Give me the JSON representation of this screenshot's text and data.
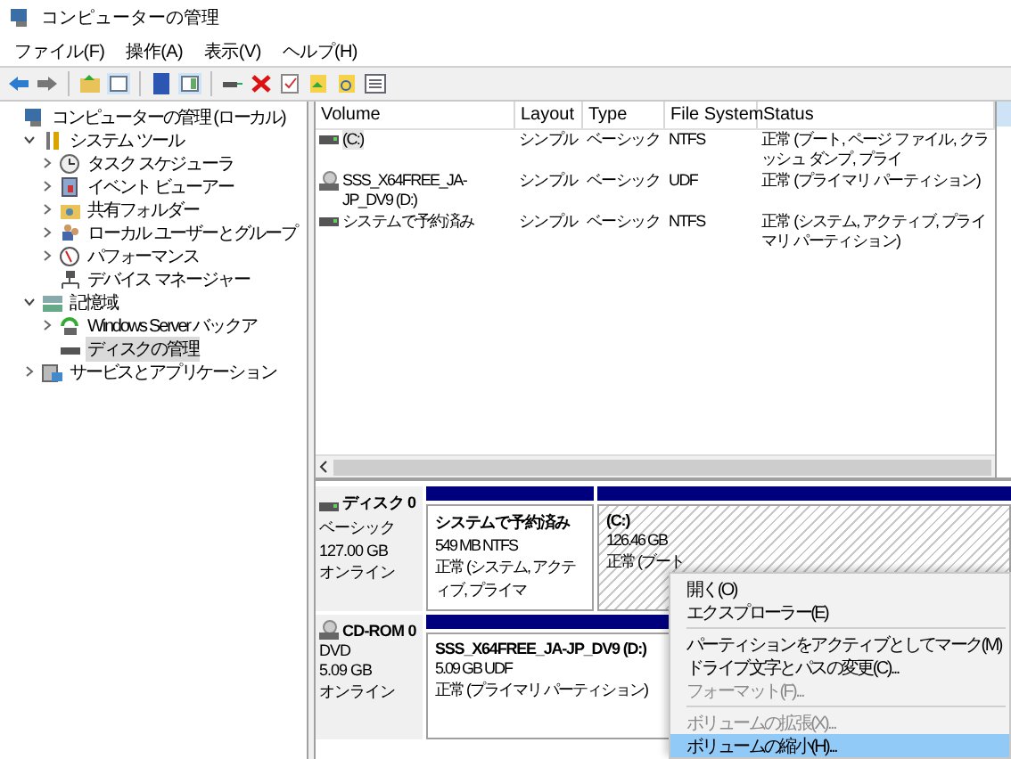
{
  "window": {
    "title": "コンピューターの管理"
  },
  "menu": [
    "ファイル(F)",
    "操作(A)",
    "表示(V)",
    "ヘルプ(H)"
  ],
  "tree": [
    {
      "label": "コンピューターの管理 (ローカル)",
      "selected": false,
      "children": [
        {
          "label": "システム ツール",
          "expanded": true,
          "selected": false,
          "children": [
            {
              "label": "タスク スケジューラ",
              "expanded": false,
              "selected": false
            },
            {
              "label": "イベント ビューアー",
              "expanded": false,
              "selected": false
            },
            {
              "label": "共有フォルダー",
              "expanded": false,
              "selected": false
            },
            {
              "label": "ローカル ユーザーとグループ",
              "expanded": false,
              "selected": false
            },
            {
              "label": "パフォーマンス",
              "expanded": false,
              "selected": false
            },
            {
              "label": "デバイス マネージャー",
              "selected": false
            }
          ]
        },
        {
          "label": "記憶域",
          "expanded": true,
          "selected": false,
          "children": [
            {
              "label": "Windows Server バックア",
              "expanded": false,
              "selected": false
            },
            {
              "label": "ディスクの管理",
              "selected": true
            }
          ]
        },
        {
          "label": "サービスとアプリケーション",
          "expanded": false,
          "selected": false
        }
      ]
    }
  ],
  "table": {
    "columns": [
      "Volume",
      "Layout",
      "Type",
      "File System",
      "Status"
    ],
    "rows": [
      {
        "kind": "disk",
        "selected": true,
        "cells": [
          "(C:)",
          "シンプル",
          "ベーシック",
          "NTFS",
          "正常 (ブート, ページ ファイル, クラッシュ ダンプ, プライ"
        ]
      },
      {
        "kind": "cdrom",
        "selected": false,
        "cells": [
          "SSS_X64FREE_JA-JP_DV9 (D:)",
          "シンプル",
          "ベーシック",
          "UDF",
          "正常 (プライマリ パーティション)"
        ]
      },
      {
        "kind": "disk",
        "selected": false,
        "cells": [
          "システムで予約済み",
          "シンプル",
          "ベーシック",
          "NTFS",
          "正常 (システム, アクティブ, プライマリ パーティション)"
        ]
      }
    ]
  },
  "disks": [
    {
      "kind": "disk",
      "name": "ディスク 0",
      "type": "ベーシック",
      "size": "127.00 GB",
      "status": "オンライン",
      "partitions": [
        {
          "title": "システムで予約済み",
          "size": "549 MB NTFS",
          "status": "正常 (システム, アクティブ, プライマ",
          "selected": false
        },
        {
          "title": "(C:)",
          "size": "126.46 GB",
          "status": "正常 (ブート",
          "selected": true
        }
      ]
    },
    {
      "kind": "cdrom",
      "name": "CD-ROM 0",
      "type": "DVD",
      "size": "5.09 GB",
      "status": "オンライン",
      "partitions": [
        {
          "title": "SSS_X64FREE_JA-JP_DV9  (D:)",
          "size": "5.09 GB UDF",
          "status": "正常 (プライマリ パーティション)",
          "selected": false
        }
      ]
    }
  ],
  "context_menu": [
    {
      "kind": "item",
      "label": "開く(O)",
      "disabled": false,
      "selected": false
    },
    {
      "kind": "item",
      "label": "エクスプローラー(E)",
      "disabled": false,
      "selected": false
    },
    {
      "kind": "separator"
    },
    {
      "kind": "item",
      "label": "パーティションをアクティブとしてマーク(M)",
      "disabled": false,
      "selected": false
    },
    {
      "kind": "item",
      "label": "ドライブ文字とパスの変更(C)...",
      "disabled": false,
      "selected": false
    },
    {
      "kind": "item",
      "label": "フォーマット(F)...",
      "disabled": true,
      "selected": false
    },
    {
      "kind": "separator"
    },
    {
      "kind": "item",
      "label": "ボリュームの拡張(X)...",
      "disabled": true,
      "selected": false
    },
    {
      "kind": "item",
      "label": "ボリュームの縮小(H)...",
      "disabled": false,
      "selected": true
    }
  ]
}
